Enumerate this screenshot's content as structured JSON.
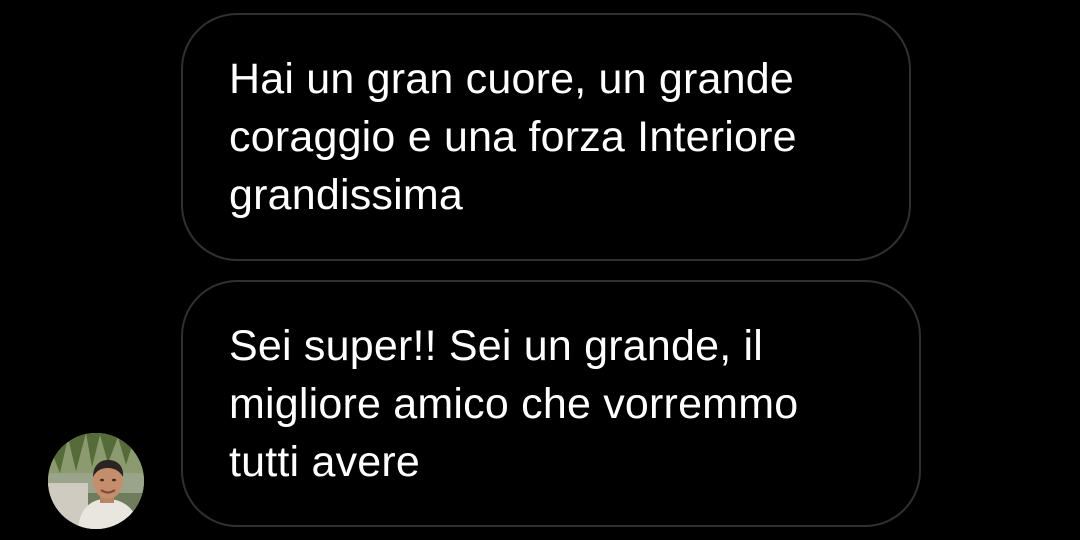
{
  "messages": [
    {
      "text": "Hai un gran cuore,  un grande\ncoraggio e una forza Interiore\ngrandissima"
    },
    {
      "text": "Sei super!! Sei un grande, il\nmigliore amico che vorremmo\ntutti avere"
    }
  ],
  "avatar": {
    "icon": "user-avatar-photo"
  },
  "colors": {
    "background": "#000000",
    "bubble_border": "#303030",
    "text": "#ffffff"
  }
}
